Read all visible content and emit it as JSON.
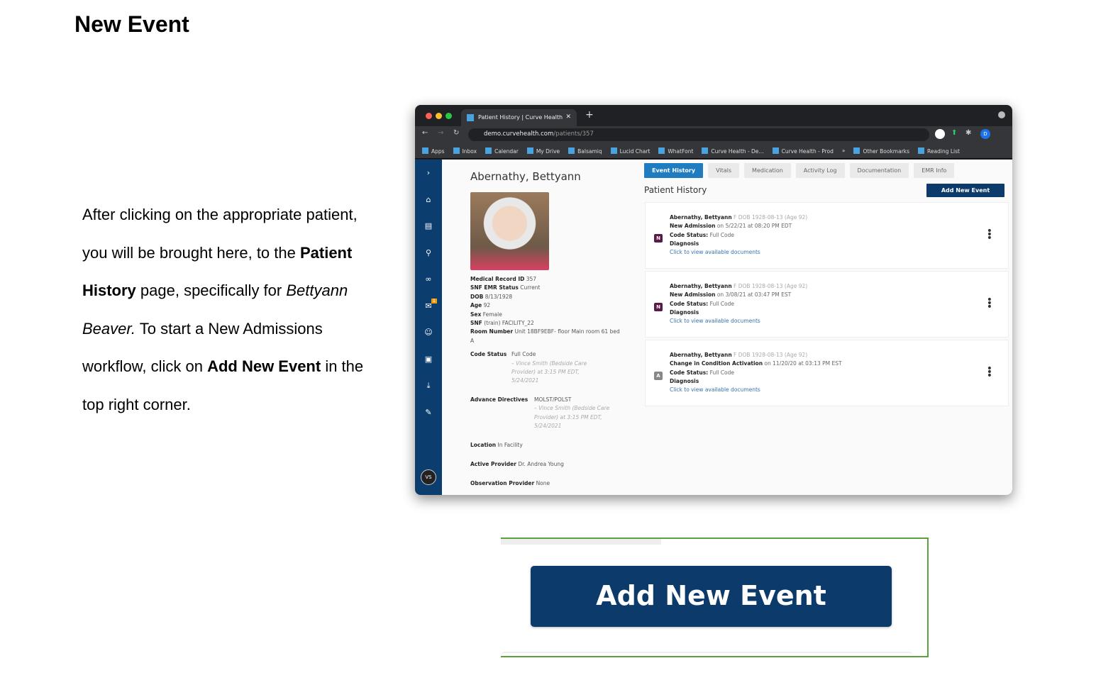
{
  "doc": {
    "title": "New Event",
    "paragraph": {
      "p1": "After clicking on the appropriate patient, you will be brought here, to the ",
      "b1": "Patient History",
      "p2": " page, specifically for ",
      "i1": "Bettyann Beaver.",
      "p3": " To start a New Admissions workflow, click on ",
      "b2": "Add New Event",
      "p4": " in the top right corner."
    }
  },
  "browser": {
    "tab_title": "Patient History | Curve Health",
    "url_host": "demo.curvehealth.com",
    "url_path": "/patients/357",
    "profile_initial": "D",
    "bookmarks": [
      "Apps",
      "Inbox",
      "Calendar",
      "My Drive",
      "Balsamiq",
      "Lucid Chart",
      "WhatFont",
      "Curve Health - De...",
      "Curve Health - Prod",
      "»",
      "Other Bookmarks",
      "Reading List"
    ]
  },
  "app": {
    "sidebar": {
      "icons": [
        "chevron-right",
        "home",
        "bed",
        "search",
        "link",
        "mail",
        "users",
        "calendar",
        "download",
        "edit"
      ],
      "mail_badge": "1",
      "avatar": "VS"
    },
    "patient": {
      "name": "Abernathy, Bettyann",
      "fields": [
        {
          "label": "Medical Record ID",
          "value": "357"
        },
        {
          "label": "SNF EMR Status",
          "value": "Current"
        },
        {
          "label": "DOB",
          "value": "8/13/1928"
        },
        {
          "label": "Age",
          "value": "92"
        },
        {
          "label": "Sex",
          "value": "Female"
        },
        {
          "label": "SNF",
          "value": "(train) FACILITY_22"
        },
        {
          "label": "Room Number",
          "value": "Unit 18BF9EBF- floor Main room 61 bed A"
        }
      ],
      "code_status": {
        "label": "Code Status",
        "value": "Full Code",
        "note": "– Vince Smith (Bedside Care Provider) at 3:15 PM EDT, 5/24/2021"
      },
      "advance_directives": {
        "label": "Advance Directives",
        "value": "MOLST/POLST",
        "note": "– Vince Smith (Bedside Care Provider) at 3:15 PM EDT, 5/24/2021"
      },
      "location": {
        "label": "Location",
        "value": "In Facility"
      },
      "active_provider": {
        "label": "Active Provider",
        "value": "Dr. Andrea Young"
      },
      "observation_provider": {
        "label": "Observation Provider",
        "value": "None"
      }
    },
    "tabs": [
      "Event History",
      "Vitals",
      "Medication",
      "Activity Log",
      "Documentation",
      "EMR Info"
    ],
    "section_title": "Patient History",
    "add_button": "Add New Event",
    "events": [
      {
        "badge": "N",
        "badge_color": "#5a1a4a",
        "name": "Abernathy, Bettyann",
        "meta": "F DOB 1928-08-13 (Age 92)",
        "type": "New Admission",
        "when": "on 5/22/21 at 08:20 PM EDT",
        "code_label": "Code Status:",
        "code": "Full Code",
        "diagnosis": "Diagnosis",
        "link": "Click to view available documents"
      },
      {
        "badge": "N",
        "badge_color": "#5a1a4a",
        "name": "Abernathy, Bettyann",
        "meta": "F DOB 1928-08-13 (Age 92)",
        "type": "New Admission",
        "when": "on 3/08/21 at 03:47 PM EST",
        "code_label": "Code Status:",
        "code": "Full Code",
        "diagnosis": "Diagnosis",
        "link": "Click to view available documents"
      },
      {
        "badge": "A",
        "badge_color": "#888888",
        "name": "Abernathy, Bettyann",
        "meta": "F DOB 1928-08-13 (Age 92)",
        "type": "Change in Condition Activation",
        "when": "on 11/20/20 at 03:13 PM EST",
        "code_label": "Code Status:",
        "code": "Full Code",
        "diagnosis": "Diagnosis",
        "link": "Click to view available documents"
      }
    ]
  },
  "zoom_callout": {
    "button": "Add New Event",
    "border_color": "#5aa33c",
    "button_color": "#0b3a6b"
  }
}
